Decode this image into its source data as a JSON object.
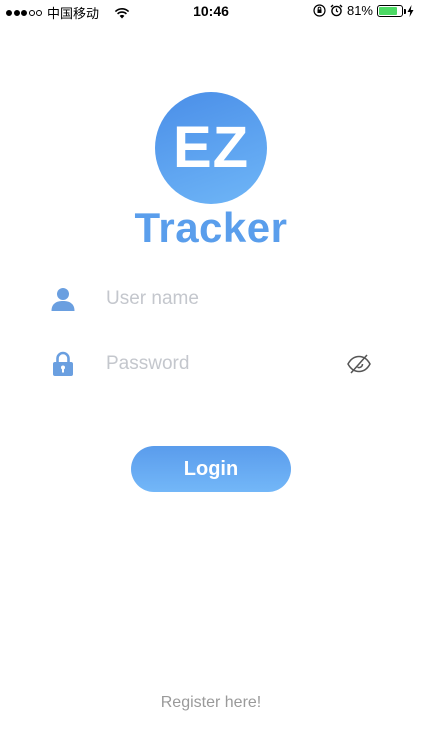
{
  "status_bar": {
    "carrier": "中国移动",
    "time": "10:46",
    "battery_percent": "81%",
    "battery_level": 0.81,
    "signal_bars_filled": 3,
    "signal_bars_total": 5
  },
  "logo": {
    "mark": "EZ",
    "wordmark": "Tracker"
  },
  "form": {
    "username_placeholder": "User name",
    "username_value": "",
    "password_placeholder": "Password",
    "password_value": ""
  },
  "login_label": "Login",
  "register_label": "Register here!",
  "colors": {
    "accent": "#5a9eec",
    "icon": "#6a9fe0",
    "placeholder": "#c4c7cd",
    "link": "#9a9a9a",
    "battery": "#4cd964"
  },
  "icons": {
    "username": "user-icon",
    "password": "lock-icon",
    "password_toggle": "eye-slash-icon"
  }
}
